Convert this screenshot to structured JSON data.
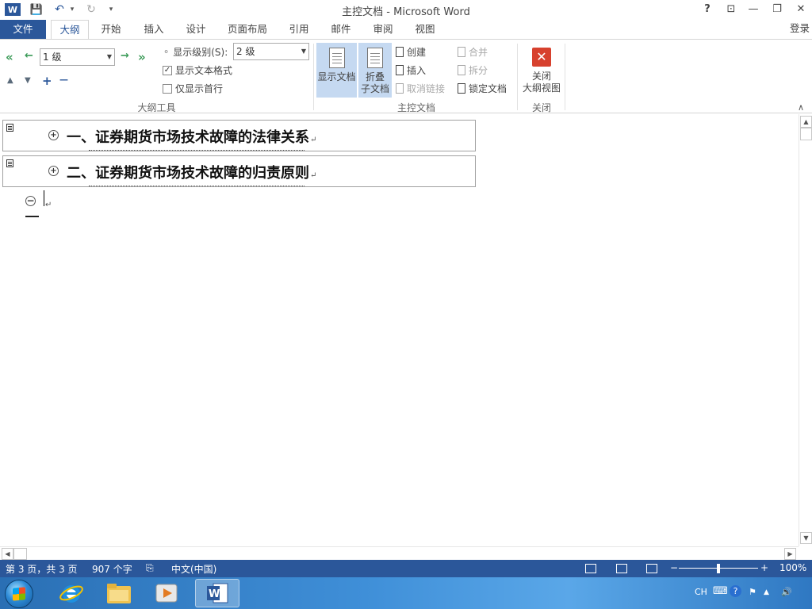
{
  "window": {
    "title": "主控文档 - Microsoft Word",
    "help": "?",
    "controls": {
      "ribbon_display": "⊡",
      "minimize": "—",
      "restore": "❐",
      "close": "✕"
    }
  },
  "qat": {
    "word_icon": "W",
    "save": "💾",
    "undo": "↶",
    "undo_dropdown": "▾",
    "redo": "↻",
    "customize": "▾"
  },
  "tabs": {
    "file": "文件",
    "items": [
      "大纲",
      "开始",
      "插入",
      "设计",
      "页面布局",
      "引用",
      "邮件",
      "审阅",
      "视图"
    ],
    "active": "大纲",
    "login": "登录"
  },
  "ribbon": {
    "outline_tools": {
      "label": "大纲工具",
      "promote_to_heading": "«",
      "promote": "←",
      "level_value": "1 级",
      "demote": "→",
      "demote_to_body": "»",
      "move_up": "▲",
      "move_down": "▼",
      "expand": "+",
      "collapse": "—",
      "show_level_label": "显示级别(S):",
      "show_level_value": "2 级",
      "show_text_format": "显示文本格式",
      "show_text_format_checked": true,
      "show_first_line": "仅显示首行",
      "show_first_line_checked": false
    },
    "master_document": {
      "label": "主控文档",
      "show_document": "显示文档",
      "collapse_subdocs_line1": "折叠",
      "collapse_subdocs_line2": "子文档",
      "create": "创建",
      "insert": "插入",
      "unlink": "取消链接",
      "merge": "合并",
      "split": "拆分",
      "lock_document": "锁定文档"
    },
    "close": {
      "label": "关闭",
      "close_outline_line1": "关闭",
      "close_outline_line2": "大纲视图",
      "close_icon": "✕"
    },
    "collapse_ribbon": "∧"
  },
  "document": {
    "headings": [
      {
        "text": "一、证券期货市场技术故障的法律关系",
        "mark": "↵",
        "expand": "+"
      },
      {
        "text": "二、证券期货市场技术故障的归责原则",
        "mark": "↵",
        "expand": "+"
      }
    ],
    "empty_para_mark": "↵",
    "empty_para_bullet": "−"
  },
  "scrollbars": {
    "up": "▲",
    "down": "▼",
    "left": "◀",
    "right": "▶"
  },
  "statusbar": {
    "page": "第 3 页，共 3 页",
    "words": "907 个字",
    "proofing_icon": "⎘",
    "language": "中文(中国)",
    "zoom_minus": "−",
    "zoom_plus": "+",
    "zoom": "100%",
    "zoom_fraction": 0.5
  },
  "taskbar": {
    "tray": {
      "lang": "CH",
      "keyboard": "⌨",
      "help": "?",
      "flag": "⚑",
      "arrow": "▲",
      "volume": "🔊"
    }
  },
  "colors": {
    "accent": "#2b579a",
    "close_red": "#d7412e",
    "selected": "#c5d9f1",
    "arrow_green": "#3a9a57"
  }
}
